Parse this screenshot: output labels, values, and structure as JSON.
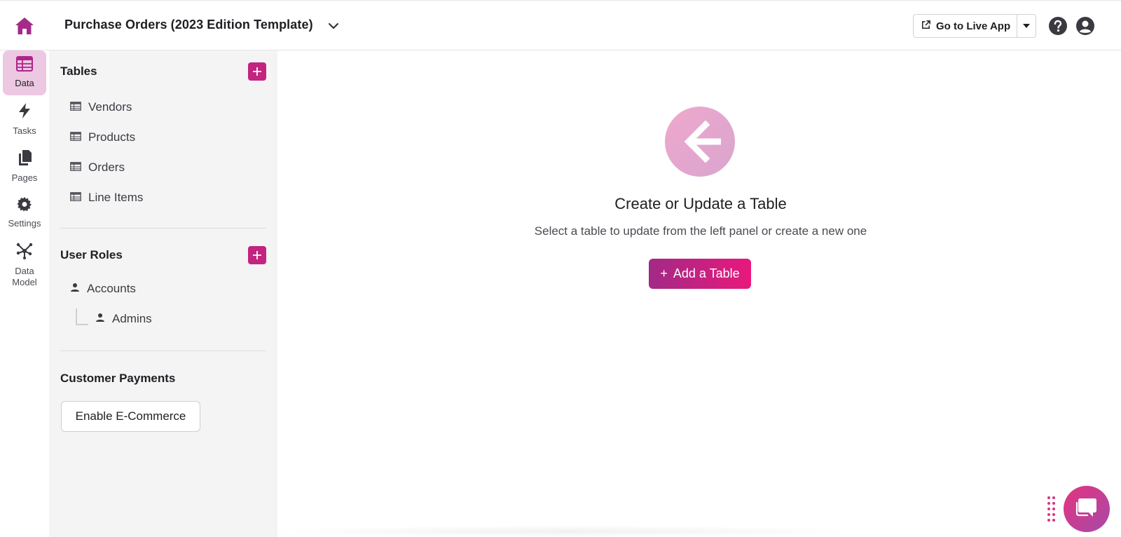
{
  "header": {
    "app_title": "Purchase Orders (2023 Edition Template)",
    "live_app_label": "Go to Live App"
  },
  "rail": {
    "items": [
      {
        "label": "Data",
        "active": true
      },
      {
        "label": "Tasks"
      },
      {
        "label": "Pages"
      },
      {
        "label": "Settings"
      },
      {
        "label": "Data\nModel"
      }
    ]
  },
  "panel": {
    "tables_title": "Tables",
    "tables": [
      "Vendors",
      "Products",
      "Orders",
      "Line Items"
    ],
    "roles_title": "User Roles",
    "roles": [
      "Accounts",
      "Admins"
    ],
    "payments_title": "Customer Payments",
    "ecommerce_label": "Enable E-Commerce"
  },
  "main": {
    "empty_title": "Create or Update a Table",
    "empty_subtitle": "Select a table to update from the left panel or create a new one",
    "add_table_label": "Add a Table",
    "add_table_plus": "+"
  },
  "colors": {
    "accent": "#c2247f",
    "active_nav_bg": "#ecc8e2",
    "panel_bg": "#f4f4f5",
    "button_gradient_start": "#a22a86",
    "button_gradient_end": "#e9187c"
  },
  "icons": {
    "home": "home-icon",
    "chevron": "chevron-down-icon",
    "external": "external-link-icon",
    "help": "help-icon",
    "user": "user-circle-icon",
    "table": "table-icon",
    "person": "person-icon",
    "arrow": "arrow-left-icon",
    "chat": "chat-icon"
  }
}
